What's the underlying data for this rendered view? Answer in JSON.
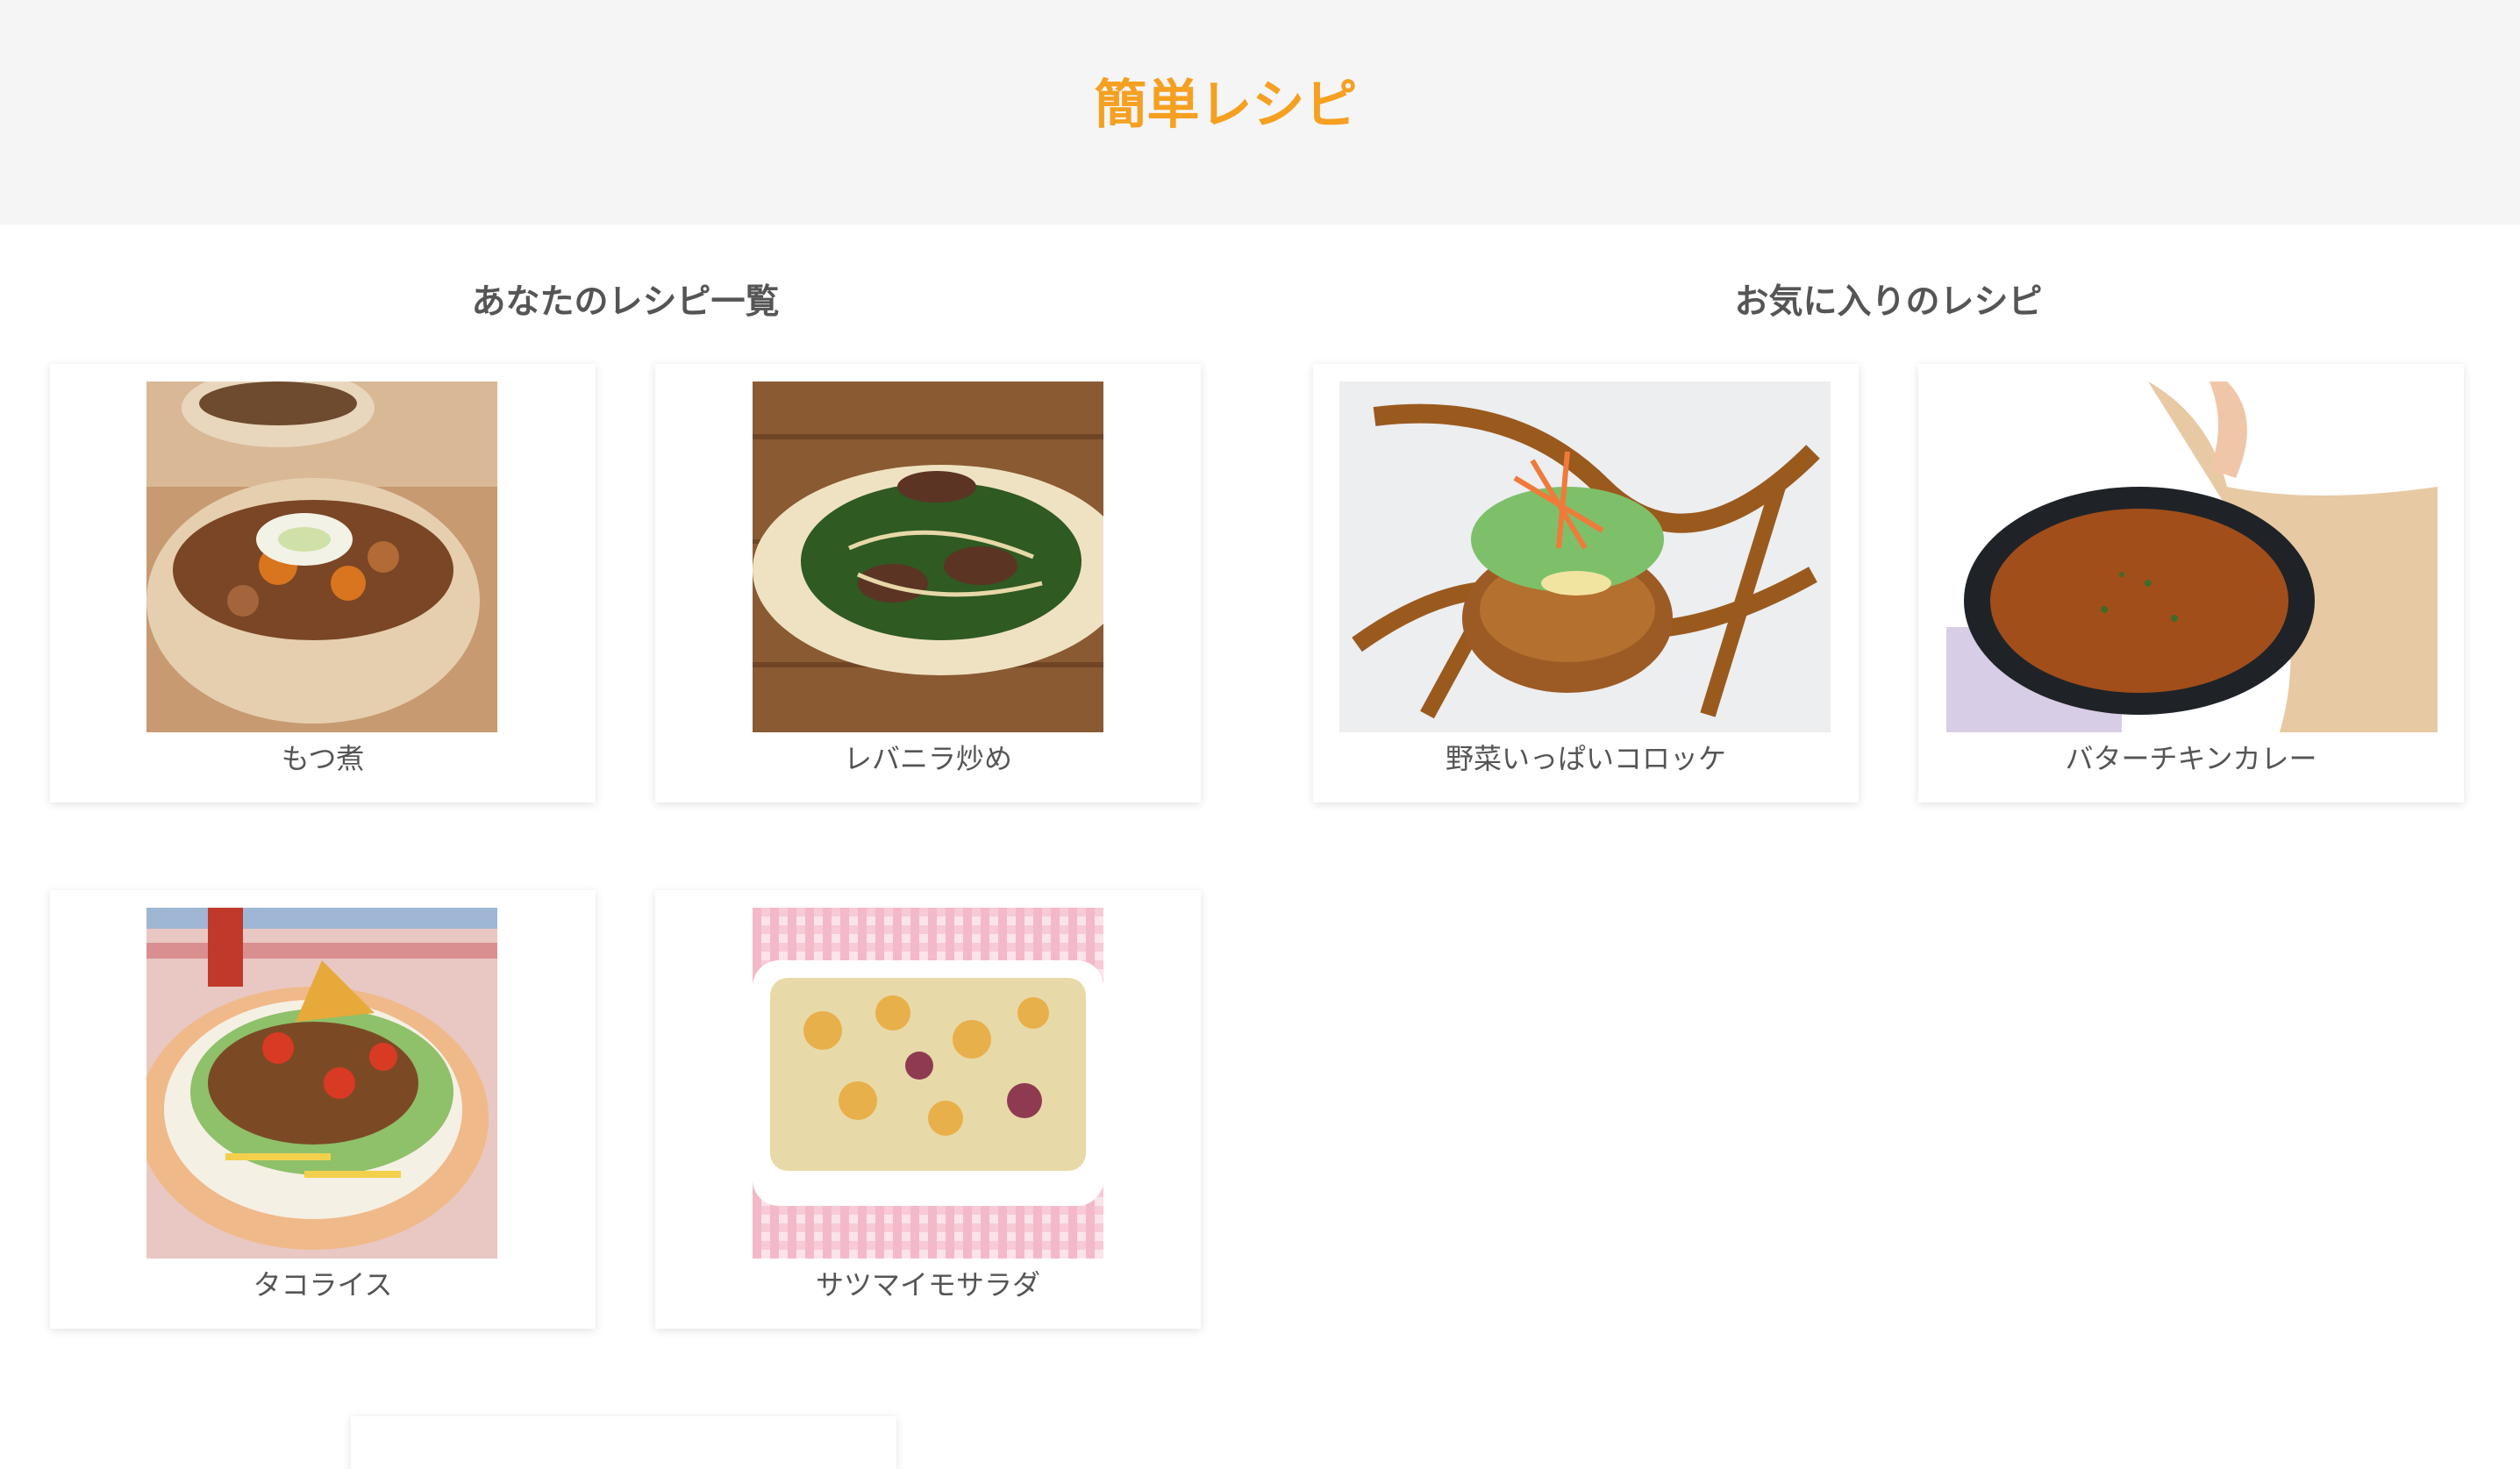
{
  "header": {
    "title": "簡単レシピ"
  },
  "sections": {
    "mine": {
      "title": "あなたのレシピ一覧",
      "recipes": [
        {
          "name": "もつ煮",
          "photo": "motsuni-photo"
        },
        {
          "name": "レバニラ炒め",
          "photo": "reba-nira-photo"
        },
        {
          "name": "タコライス",
          "photo": "taco-rice-photo"
        },
        {
          "name": "サツマイモサラダ",
          "photo": "sweet-potato-salad-photo"
        }
      ]
    },
    "favorites": {
      "title": "お気に入りのレシピ",
      "recipes": [
        {
          "name": "野菜いっぱいコロッケ",
          "photo": "croquette-photo"
        },
        {
          "name": "バターチキンカレー",
          "photo": "butter-chicken-curry-photo"
        }
      ]
    }
  },
  "colors": {
    "accent": "#f5a020",
    "header_bg": "#f5f5f5",
    "text": "#555555",
    "card_bg": "#ffffff"
  }
}
